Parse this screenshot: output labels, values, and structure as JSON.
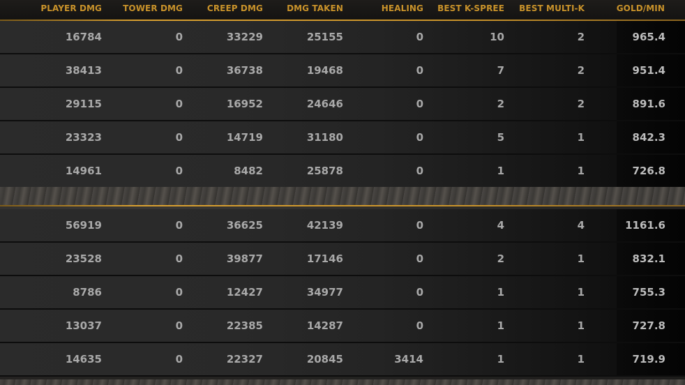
{
  "columns": [
    {
      "key": "player_dmg",
      "label": "PLAYER DMG"
    },
    {
      "key": "tower_dmg",
      "label": "TOWER DMG"
    },
    {
      "key": "creep_dmg",
      "label": "CREEP DMG"
    },
    {
      "key": "dmg_taken",
      "label": "DMG TAKEN"
    },
    {
      "key": "healing",
      "label": "HEALING"
    },
    {
      "key": "best_k_spree",
      "label": "BEST K-SPREE"
    },
    {
      "key": "best_multi_k",
      "label": "BEST MULTI-K"
    },
    {
      "key": "gold_min",
      "label": "GOLD/MIN"
    }
  ],
  "colors": {
    "header_text": "#c8922a",
    "accent_line": "#d9a030",
    "cell_text": "#a9a9a9"
  },
  "teams": [
    {
      "rows": [
        [
          "16784",
          "0",
          "33229",
          "25155",
          "0",
          "10",
          "2",
          "965.4"
        ],
        [
          "38413",
          "0",
          "36738",
          "19468",
          "0",
          "7",
          "2",
          "951.4"
        ],
        [
          "29115",
          "0",
          "16952",
          "24646",
          "0",
          "2",
          "2",
          "891.6"
        ],
        [
          "23323",
          "0",
          "14719",
          "31180",
          "0",
          "5",
          "1",
          "842.3"
        ],
        [
          "14961",
          "0",
          "8482",
          "25878",
          "0",
          "1",
          "1",
          "726.8"
        ]
      ]
    },
    {
      "rows": [
        [
          "56919",
          "0",
          "36625",
          "42139",
          "0",
          "4",
          "4",
          "1161.6"
        ],
        [
          "23528",
          "0",
          "39877",
          "17146",
          "0",
          "2",
          "1",
          "832.1"
        ],
        [
          "8786",
          "0",
          "12427",
          "34977",
          "0",
          "1",
          "1",
          "755.3"
        ],
        [
          "13037",
          "0",
          "22385",
          "14287",
          "0",
          "1",
          "1",
          "727.8"
        ],
        [
          "14635",
          "0",
          "22327",
          "20845",
          "3414",
          "1",
          "1",
          "719.9"
        ]
      ]
    }
  ]
}
